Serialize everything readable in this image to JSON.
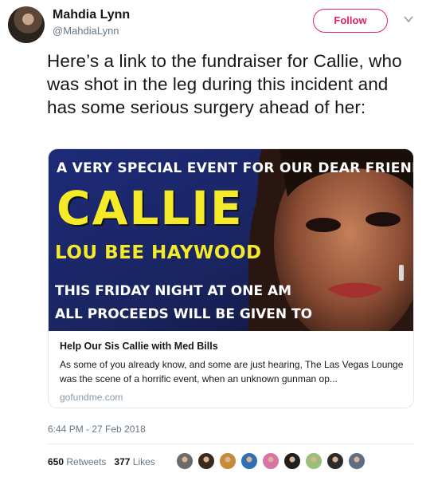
{
  "user": {
    "name": "Mahdia Lynn",
    "handle": "@MahdiaLynn"
  },
  "header": {
    "follow_label": "Follow"
  },
  "tweet": {
    "text": "Here’s a link to the fundraiser for Callie, who was shot in the leg during this incident and has some serious surgery ahead of her:",
    "timestamp": "6:44 PM - 27 Feb 2018"
  },
  "card": {
    "image_lines": {
      "line1": "A VERY SPECIAL EVENT FOR OUR DEAR FRIEND",
      "headline": "CALLIE",
      "fullname": "LOU BEE HAYWOOD",
      "line3": "THIS FRIDAY NIGHT AT ONE AM",
      "line4": "ALL PROCEEDS WILL BE GIVEN TO"
    },
    "title": "Help Our Sis Callie with Med Bills",
    "description": "As some of you already know, and some are just hearing, The Las Vegas Lounge was the scene of a horrific event, when an unknown gunman op...",
    "domain": "gofundme.com"
  },
  "stats": {
    "retweets_count": "650",
    "retweets_label": "Retweets",
    "likes_count": "377",
    "likes_label": "Likes"
  },
  "likers": [
    {
      "name": "liker-avatar-1",
      "color": "#6b6b6b"
    },
    {
      "name": "liker-avatar-2",
      "color": "#3a2a1e"
    },
    {
      "name": "liker-avatar-3",
      "color": "#c58a3b"
    },
    {
      "name": "liker-avatar-4",
      "color": "#2f6fb3"
    },
    {
      "name": "liker-avatar-5",
      "color": "#d873a8"
    },
    {
      "name": "liker-avatar-6",
      "color": "#1f1f1f"
    },
    {
      "name": "liker-avatar-7",
      "color": "#9bbf7a"
    },
    {
      "name": "liker-avatar-8",
      "color": "#2b2b2b"
    },
    {
      "name": "liker-avatar-9",
      "color": "#5d6e80"
    }
  ],
  "colors": {
    "accent": "#e0245e",
    "secondary_text": "#657786",
    "highlight_yellow": "#f4ea2a"
  }
}
